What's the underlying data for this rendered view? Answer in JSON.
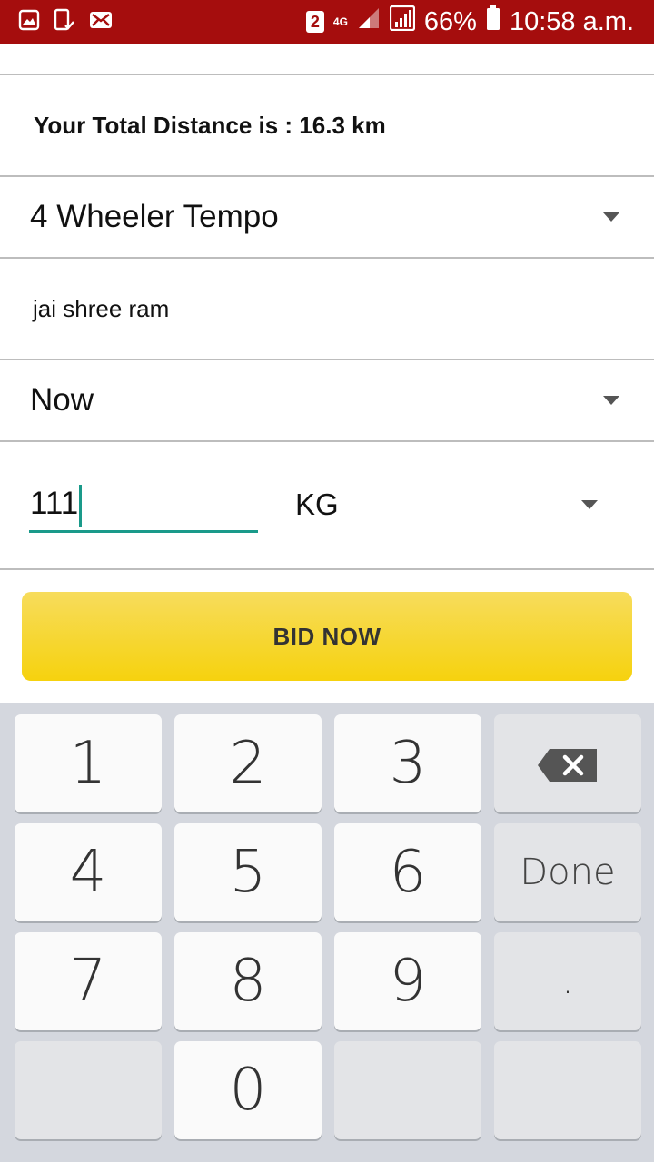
{
  "status_bar": {
    "sim_slot": "2",
    "network_type": "4G",
    "battery_percent": "66%",
    "time": "10:58 a.m.",
    "icons": [
      "gallery-icon",
      "device-check-icon",
      "mail-icon",
      "sim-badge-icon",
      "signal-icon",
      "signal-full-icon",
      "battery-icon"
    ],
    "background_color": "#a50d0d"
  },
  "distance": {
    "text": "Your Total Distance is : 16.3 km"
  },
  "vehicle_select": {
    "value": "4 Wheeler Tempo"
  },
  "note": {
    "text": "jai shree ram"
  },
  "time_select": {
    "value": "Now"
  },
  "weight": {
    "value": "111",
    "unit": "KG"
  },
  "bid_button": {
    "label": "BID NOW",
    "color": "#f6d20e"
  },
  "keyboard": {
    "keys": [
      "1",
      "2",
      "3",
      "4",
      "5",
      "6",
      "7",
      "8",
      "9",
      "0"
    ],
    "done_label": "Done",
    "dot_label": ".",
    "backspace_icon": "backspace-icon"
  }
}
